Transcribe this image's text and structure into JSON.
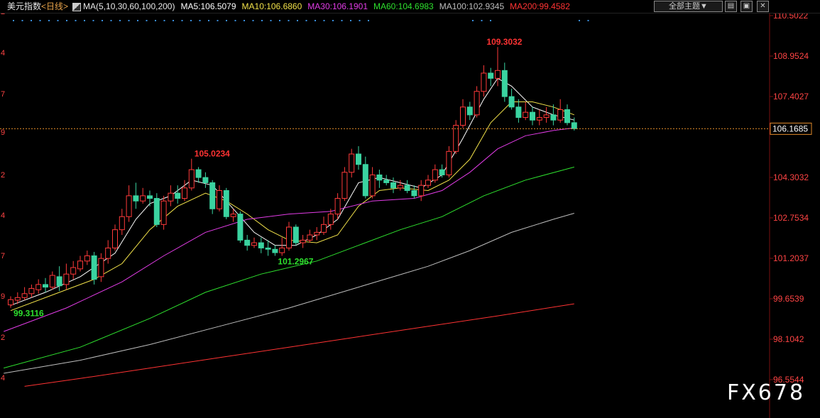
{
  "header": {
    "title": "美元指数",
    "period": "<日线>",
    "ma_label": "MA(5,10,30,60,100,200)",
    "ma_values": [
      {
        "text": "MA5:106.5079",
        "color": "#ffffff"
      },
      {
        "text": "MA10:106.6860",
        "color": "#f2e24a"
      },
      {
        "text": "MA30:106.1901",
        "color": "#e23ce6"
      },
      {
        "text": "MA60:104.6983",
        "color": "#2ee02e"
      },
      {
        "text": "MA100:102.9345",
        "color": "#bdbdbd"
      },
      {
        "text": "MA200:99.4582",
        "color": "#ff3333"
      }
    ],
    "theme_select": "全部主题▼",
    "window_buttons": [
      "▤",
      "▣",
      "✕"
    ]
  },
  "watermark": "FX678",
  "chart_data": {
    "type": "candlestick",
    "y_axis_labels": [
      "110.5022",
      "108.9524",
      "107.4027",
      "104.3032",
      "102.7534",
      "101.2037",
      "99.6539",
      "98.1042",
      "96.5544"
    ],
    "y_axis_values": [
      110.5022,
      108.9524,
      107.4027,
      104.3032,
      102.7534,
      101.2037,
      99.6539,
      98.1042,
      96.5544
    ],
    "ylim": [
      96.3,
      110.65
    ],
    "current_price": "106.1685",
    "current_value": 106.1685,
    "annotations": [
      {
        "text": "109.3032",
        "value": 109.3032,
        "bar": 68,
        "color": "#ff3333"
      },
      {
        "text": "105.0234",
        "value": 105.0234,
        "bar": 26,
        "color": "#ff3333"
      },
      {
        "text": "101.2967",
        "value": 101.2967,
        "bar": 38,
        "color": "#2ee02e"
      },
      {
        "text": "99.3116",
        "value": 99.3116,
        "bar": 0,
        "color": "#2ee02e"
      }
    ],
    "candles": [
      [
        99.42,
        99.62,
        99.31,
        99.75
      ],
      [
        99.6,
        99.7,
        99.45,
        99.9
      ],
      [
        99.7,
        99.85,
        99.6,
        100.1
      ],
      [
        99.85,
        100.05,
        99.7,
        100.2
      ],
      [
        100.0,
        100.2,
        99.85,
        100.4
      ],
      [
        100.2,
        100.1,
        99.9,
        100.45
      ],
      [
        100.1,
        100.55,
        100.0,
        100.7
      ],
      [
        100.5,
        100.15,
        99.95,
        100.9
      ],
      [
        100.2,
        100.6,
        100.0,
        101.0
      ],
      [
        100.6,
        100.85,
        100.4,
        101.1
      ],
      [
        100.8,
        101.1,
        100.7,
        101.3
      ],
      [
        101.1,
        101.3,
        100.95,
        101.5
      ],
      [
        101.3,
        100.4,
        100.2,
        101.45
      ],
      [
        100.5,
        101.2,
        100.3,
        101.4
      ],
      [
        101.2,
        101.6,
        101.0,
        101.9
      ],
      [
        101.6,
        102.3,
        101.5,
        102.5
      ],
      [
        102.3,
        102.8,
        102.1,
        103.1
      ],
      [
        102.8,
        103.6,
        102.6,
        104.0
      ],
      [
        103.6,
        103.4,
        103.1,
        104.1
      ],
      [
        103.4,
        103.6,
        103.3,
        103.9
      ],
      [
        103.6,
        103.5,
        103.2,
        103.8
      ],
      [
        103.5,
        102.5,
        102.4,
        103.7
      ],
      [
        102.5,
        103.4,
        102.3,
        103.6
      ],
      [
        103.4,
        103.7,
        103.2,
        104.0
      ],
      [
        103.7,
        103.5,
        103.3,
        104.0
      ],
      [
        103.5,
        103.9,
        103.4,
        104.2
      ],
      [
        103.9,
        104.6,
        103.8,
        105.02
      ],
      [
        104.6,
        104.3,
        104.1,
        104.7
      ],
      [
        104.3,
        104.1,
        103.9,
        104.5
      ],
      [
        104.1,
        103.1,
        102.9,
        104.2
      ],
      [
        103.1,
        103.8,
        103.0,
        104.0
      ],
      [
        103.8,
        102.8,
        102.7,
        103.9
      ],
      [
        102.8,
        102.9,
        102.6,
        103.1
      ],
      [
        102.9,
        101.9,
        101.8,
        103.0
      ],
      [
        101.9,
        101.7,
        101.5,
        102.1
      ],
      [
        101.7,
        101.8,
        101.6,
        102.0
      ],
      [
        101.8,
        101.6,
        101.4,
        102.0
      ],
      [
        101.6,
        101.55,
        101.3,
        101.9
      ],
      [
        101.55,
        101.42,
        101.3,
        101.7
      ],
      [
        101.42,
        101.6,
        101.3,
        102.0
      ],
      [
        101.6,
        102.4,
        101.5,
        102.6
      ],
      [
        102.4,
        101.8,
        101.7,
        102.5
      ],
      [
        101.8,
        101.9,
        101.6,
        102.1
      ],
      [
        101.9,
        102.1,
        101.8,
        102.3
      ],
      [
        102.1,
        102.2,
        101.9,
        102.4
      ],
      [
        102.2,
        102.5,
        102.1,
        102.8
      ],
      [
        102.5,
        102.9,
        102.3,
        103.1
      ],
      [
        102.9,
        103.5,
        102.7,
        103.7
      ],
      [
        103.5,
        104.5,
        103.4,
        104.7
      ],
      [
        104.5,
        105.2,
        104.3,
        105.4
      ],
      [
        105.2,
        104.8,
        104.6,
        105.5
      ],
      [
        104.8,
        103.6,
        103.5,
        105.1
      ],
      [
        103.6,
        104.4,
        103.5,
        104.7
      ],
      [
        104.4,
        104.2,
        103.9,
        104.6
      ],
      [
        104.2,
        104.1,
        104.0,
        104.4
      ],
      [
        104.1,
        103.9,
        103.7,
        104.3
      ],
      [
        103.9,
        104.0,
        103.8,
        104.2
      ],
      [
        104.0,
        103.8,
        103.7,
        104.2
      ],
      [
        103.8,
        103.6,
        103.5,
        104.0
      ],
      [
        103.6,
        104.0,
        103.4,
        104.2
      ],
      [
        104.0,
        104.2,
        103.9,
        104.4
      ],
      [
        104.2,
        104.6,
        104.1,
        104.8
      ],
      [
        104.6,
        104.4,
        104.3,
        104.8
      ],
      [
        104.4,
        105.3,
        104.3,
        105.5
      ],
      [
        105.3,
        106.3,
        105.2,
        106.5
      ],
      [
        106.3,
        107.0,
        106.2,
        107.3
      ],
      [
        107.0,
        106.7,
        106.5,
        107.2
      ],
      [
        106.7,
        107.6,
        106.6,
        107.8
      ],
      [
        107.6,
        108.3,
        107.4,
        108.6
      ],
      [
        108.3,
        108.1,
        107.8,
        108.5
      ],
      [
        108.1,
        108.4,
        107.8,
        109.3
      ],
      [
        108.4,
        107.4,
        107.2,
        108.7
      ],
      [
        107.4,
        107.0,
        106.9,
        107.7
      ],
      [
        107.0,
        106.6,
        106.4,
        107.3
      ],
      [
        106.6,
        106.8,
        106.5,
        107.2
      ],
      [
        106.8,
        106.5,
        106.3,
        107.0
      ],
      [
        106.5,
        106.6,
        106.3,
        106.9
      ],
      [
        106.6,
        106.7,
        106.4,
        107.0
      ],
      [
        106.7,
        106.5,
        106.3,
        107.1
      ],
      [
        106.5,
        106.9,
        106.4,
        107.3
      ],
      [
        106.9,
        106.4,
        106.3,
        107.1
      ],
      [
        106.4,
        106.17,
        106.1,
        106.6
      ]
    ],
    "series": [
      {
        "name": "MA5",
        "color": "#ffffff",
        "points": [
          [
            0,
            99.4
          ],
          [
            5,
            99.9
          ],
          [
            10,
            100.5
          ],
          [
            15,
            101.4
          ],
          [
            18,
            102.7
          ],
          [
            20,
            103.3
          ],
          [
            23,
            103.6
          ],
          [
            26,
            104.2
          ],
          [
            29,
            104.0
          ],
          [
            32,
            103.1
          ],
          [
            35,
            102.2
          ],
          [
            38,
            101.7
          ],
          [
            41,
            101.7
          ],
          [
            44,
            102.1
          ],
          [
            47,
            102.7
          ],
          [
            50,
            104.1
          ],
          [
            53,
            104.3
          ],
          [
            56,
            104.1
          ],
          [
            59,
            103.9
          ],
          [
            62,
            104.4
          ],
          [
            65,
            105.8
          ],
          [
            68,
            107.3
          ],
          [
            70,
            108.1
          ],
          [
            72,
            107.8
          ],
          [
            75,
            107.0
          ],
          [
            78,
            106.7
          ],
          [
            81,
            106.5
          ]
        ]
      },
      {
        "name": "MA10",
        "color": "#f2e24a",
        "points": [
          [
            0,
            99.2
          ],
          [
            6,
            99.8
          ],
          [
            12,
            100.4
          ],
          [
            16,
            101.0
          ],
          [
            20,
            102.3
          ],
          [
            24,
            103.2
          ],
          [
            28,
            103.7
          ],
          [
            31,
            103.4
          ],
          [
            34,
            102.9
          ],
          [
            37,
            102.3
          ],
          [
            40,
            101.9
          ],
          [
            44,
            101.8
          ],
          [
            47,
            102.1
          ],
          [
            50,
            103.2
          ],
          [
            53,
            103.8
          ],
          [
            56,
            103.9
          ],
          [
            60,
            103.8
          ],
          [
            63,
            104.2
          ],
          [
            66,
            105.0
          ],
          [
            69,
            106.4
          ],
          [
            72,
            107.2
          ],
          [
            75,
            107.2
          ],
          [
            78,
            107.0
          ],
          [
            81,
            106.7
          ]
        ]
      },
      {
        "name": "MA30",
        "color": "#e23ce6",
        "points": [
          [
            -1,
            98.4
          ],
          [
            8,
            99.3
          ],
          [
            16,
            100.3
          ],
          [
            22,
            101.3
          ],
          [
            28,
            102.2
          ],
          [
            34,
            102.7
          ],
          [
            40,
            102.9
          ],
          [
            46,
            103.0
          ],
          [
            52,
            103.4
          ],
          [
            58,
            103.5
          ],
          [
            62,
            103.8
          ],
          [
            66,
            104.5
          ],
          [
            70,
            105.4
          ],
          [
            74,
            105.9
          ],
          [
            78,
            106.1
          ],
          [
            81,
            106.2
          ]
        ]
      },
      {
        "name": "MA60",
        "color": "#2ee02e",
        "points": [
          [
            -1,
            97.0
          ],
          [
            10,
            97.8
          ],
          [
            20,
            98.9
          ],
          [
            28,
            99.9
          ],
          [
            36,
            100.6
          ],
          [
            44,
            101.1
          ],
          [
            50,
            101.7
          ],
          [
            56,
            102.3
          ],
          [
            62,
            102.8
          ],
          [
            68,
            103.6
          ],
          [
            74,
            104.2
          ],
          [
            81,
            104.7
          ]
        ]
      },
      {
        "name": "MA100",
        "color": "#bdbdbd",
        "points": [
          [
            -1,
            96.8
          ],
          [
            10,
            97.3
          ],
          [
            20,
            97.9
          ],
          [
            30,
            98.6
          ],
          [
            40,
            99.3
          ],
          [
            50,
            100.1
          ],
          [
            60,
            100.9
          ],
          [
            66,
            101.5
          ],
          [
            72,
            102.2
          ],
          [
            78,
            102.7
          ],
          [
            81,
            102.93
          ]
        ]
      },
      {
        "name": "MA200",
        "color": "#ff3333",
        "points": [
          [
            2,
            96.3
          ],
          [
            10,
            96.6
          ],
          [
            20,
            97.0
          ],
          [
            30,
            97.4
          ],
          [
            40,
            97.8
          ],
          [
            50,
            98.2
          ],
          [
            60,
            98.6
          ],
          [
            70,
            99.0
          ],
          [
            81,
            99.46
          ]
        ]
      }
    ],
    "grid": false
  }
}
